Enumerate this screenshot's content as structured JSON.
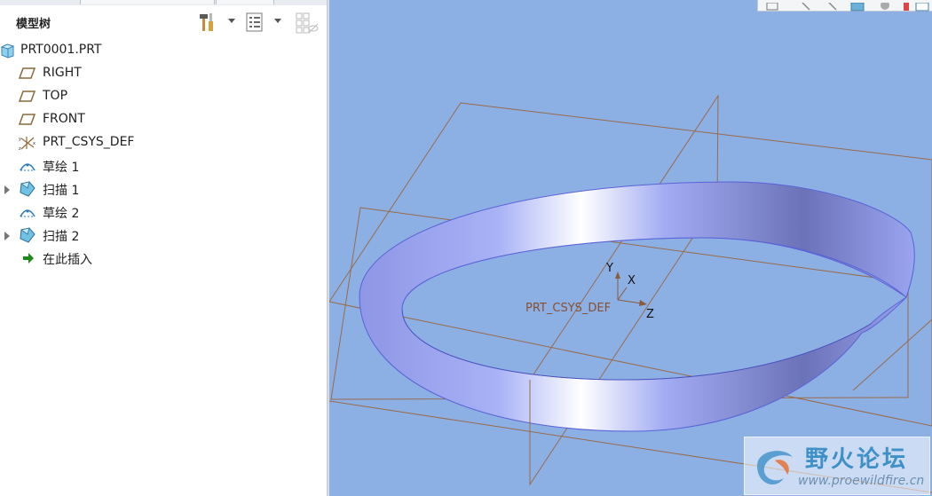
{
  "panel": {
    "title": "模型树"
  },
  "tree": {
    "items": [
      {
        "label": "PRT0001.PRT",
        "icon": "part-icon",
        "expander": false
      },
      {
        "label": "RIGHT",
        "icon": "datum-plane-icon",
        "expander": false
      },
      {
        "label": "TOP",
        "icon": "datum-plane-icon",
        "expander": false
      },
      {
        "label": "FRONT",
        "icon": "datum-plane-icon",
        "expander": false
      },
      {
        "label": "PRT_CSYS_DEF",
        "icon": "coordinate-system-icon",
        "expander": false
      },
      {
        "label": "草绘 1",
        "icon": "sketch-icon",
        "expander": false
      },
      {
        "label": "扫描 1",
        "icon": "sweep-icon",
        "expander": true
      },
      {
        "label": "草绘 2",
        "icon": "sketch-icon",
        "expander": false
      },
      {
        "label": "扫描 2",
        "icon": "sweep-icon",
        "expander": true
      },
      {
        "label": "在此插入",
        "icon": "insert-here-arrow-icon",
        "expander": false
      }
    ]
  },
  "viewport": {
    "csys_label": "PRT_CSYS_DEF",
    "axis_x": "X",
    "axis_y": "Y",
    "axis_z": "Z"
  },
  "watermark": {
    "title": "野火论坛",
    "url": "www.proewildfire.cn"
  },
  "colors": {
    "viewport_bg": "#8cb0e4",
    "datum_plane": "#9a6a4a",
    "surface": "#7d86d6",
    "insert_arrow": "#1a8a1a"
  }
}
